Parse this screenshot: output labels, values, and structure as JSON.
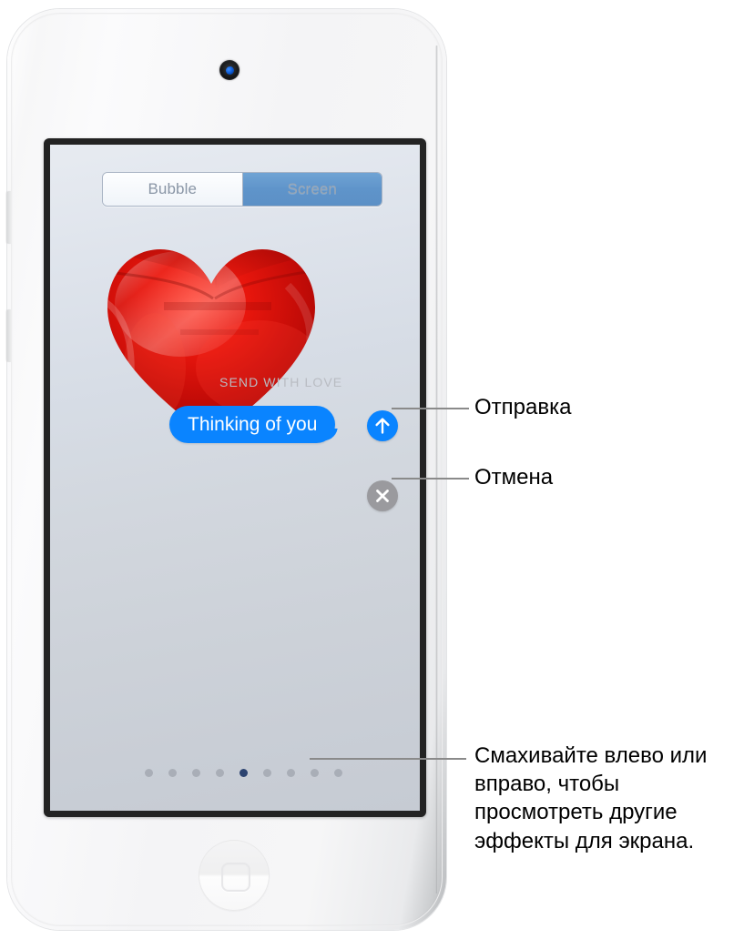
{
  "device": {
    "name": "iPod touch",
    "camera_icon": "front-camera",
    "home_button_icon": "home-square-icon"
  },
  "screen": {
    "segmented_control": {
      "options": [
        {
          "label": "Bubble",
          "selected": false
        },
        {
          "label": "Screen",
          "selected": true
        }
      ]
    },
    "effect": {
      "name": "Love",
      "balloon_icon": "red-heart-balloon",
      "overlay_text": "SEND WITH LOVE"
    },
    "message": {
      "bubble_text": "Thinking of you",
      "bubble_color": "#0a84ff",
      "bubble_text_color": "#ffffff"
    },
    "buttons": {
      "send": {
        "icon": "arrow-up-icon",
        "color": "#0a84ff"
      },
      "cancel": {
        "icon": "close-x-icon",
        "color": "#9a9a9e"
      }
    },
    "page_dots": {
      "total": 9,
      "active_index": 4,
      "inactive_color": "#a9aeb7",
      "active_color": "#2c4370"
    }
  },
  "callouts": [
    {
      "id": "send",
      "label": "Отправка"
    },
    {
      "id": "cancel",
      "label": "Отмена"
    },
    {
      "id": "swipe",
      "label": "Смахивайте влево или вправо, чтобы просмотреть другие эффекты для экрана."
    }
  ]
}
